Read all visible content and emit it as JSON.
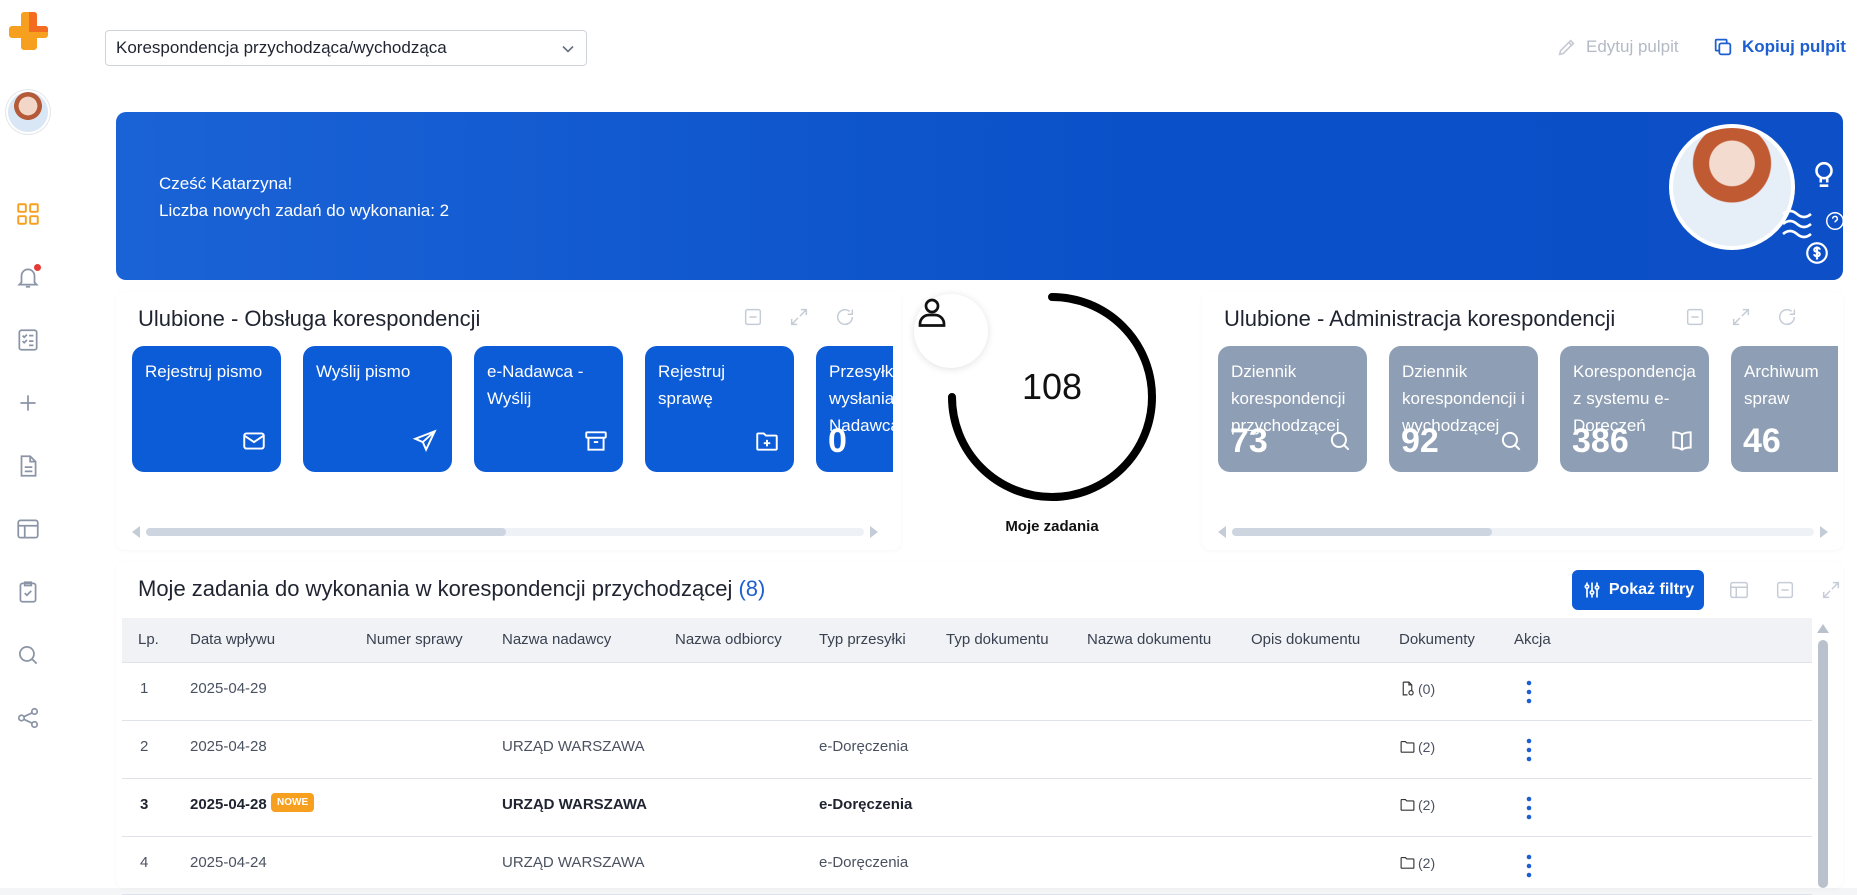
{
  "top": {
    "dashboard_select": "Korespondencja przychodząca/wychodząca",
    "edit_label": "Edytuj pulpit",
    "copy_label": "Kopiuj pulpit"
  },
  "banner": {
    "greeting": "Cześć Katarzyna!",
    "tasks_line": "Liczba nowych zadań do wykonania: 2"
  },
  "fav_left": {
    "title": "Ulubione - Obsługa korespondencji",
    "tiles": [
      {
        "label": "Rejestruj pismo",
        "icon": "mail-icon"
      },
      {
        "label": "Wyślij pismo",
        "icon": "send-icon"
      },
      {
        "label": "e-Nadawca - Wyślij",
        "icon": "archive-icon"
      },
      {
        "label": "Rejestruj sprawę",
        "icon": "folder-plus-icon"
      },
      {
        "label": "Przesyłki do wysłania e-Nadawca",
        "count": "0"
      }
    ]
  },
  "gauge": {
    "value": "108",
    "label": "Moje zadania"
  },
  "fav_right": {
    "title": "Ulubione - Administracja korespondencji",
    "tiles": [
      {
        "label": "Dziennik korespondencji przychodzącej",
        "count": "73",
        "icon": "search-icon"
      },
      {
        "label": "Dziennik korespondencji i wychodzącej",
        "count": "92",
        "icon": "search-icon"
      },
      {
        "label": "Korespondencja z systemu e-Doręczeń",
        "count": "386",
        "icon": "book-icon"
      },
      {
        "label": "Archiwum spraw",
        "count": "46"
      }
    ]
  },
  "tasks": {
    "title": "Moje zadania do wykonania w korespondencji przychodzącej",
    "count": "(8)",
    "filter_label": "Pokaż filtry",
    "columns": [
      "Lp.",
      "Data wpływu",
      "Numer sprawy",
      "Nazwa nadawcy",
      "Nazwa odbiorcy",
      "Typ przesyłki",
      "Typ dokumentu",
      "Nazwa dokumentu",
      "Opis dokumentu",
      "Dokumenty",
      "Akcja"
    ],
    "new_badge": "NOWE",
    "rows": [
      {
        "lp": "1",
        "date": "2025-04-29",
        "sender": "",
        "type": "",
        "docs": "(0)"
      },
      {
        "lp": "2",
        "date": "2025-04-28",
        "sender": "URZĄD WARSZAWA",
        "type": "e-Doręczenia",
        "docs": "(2)"
      },
      {
        "lp": "3",
        "date": "2025-04-28",
        "sender": "URZĄD WARSZAWA",
        "type": "e-Doręczenia",
        "docs": "(2)"
      },
      {
        "lp": "4",
        "date": "2025-04-24",
        "sender": "URZĄD WARSZAWA",
        "type": "e-Doręczenia",
        "docs": "(2)"
      }
    ]
  },
  "colors": {
    "primary": "#0c5bd7",
    "tile_gray": "#8e9eb4",
    "accent_orange": "#f7a020",
    "banner": "#0a50c8"
  }
}
